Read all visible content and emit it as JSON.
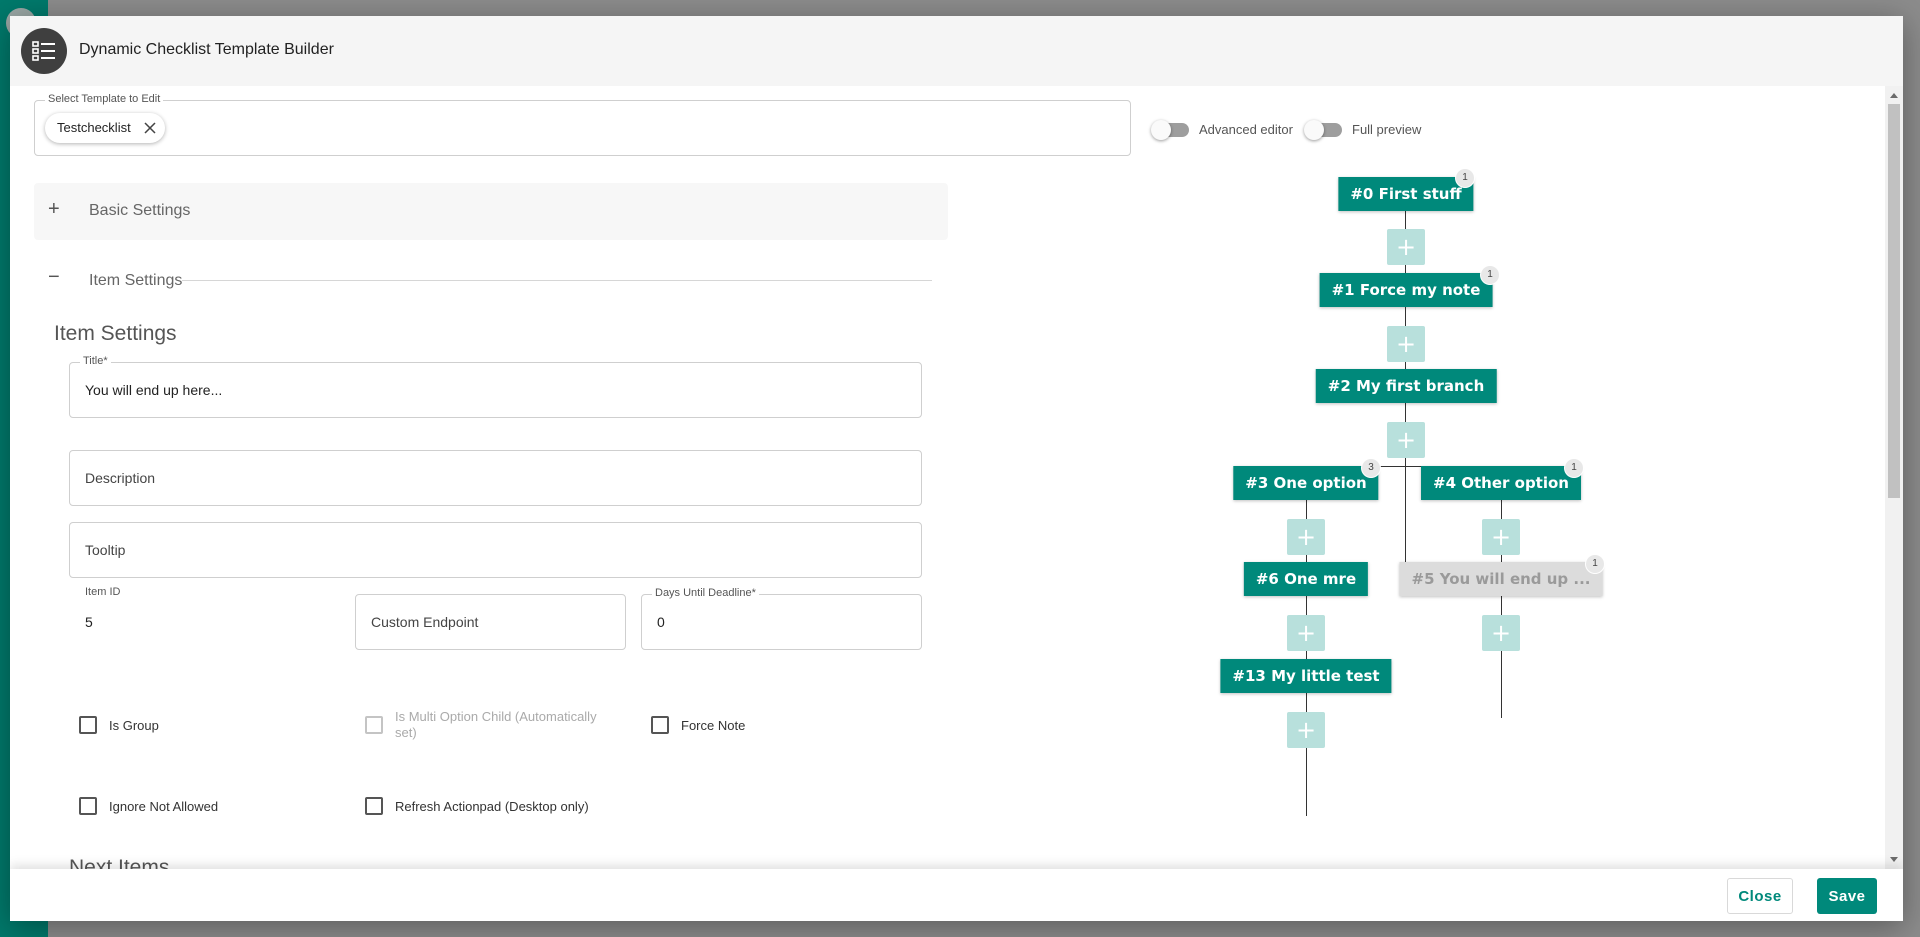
{
  "dialog": {
    "title": "Dynamic Checklist Template Builder"
  },
  "template_select": {
    "label": "Select Template to Edit",
    "chip": "Testchecklist"
  },
  "toggles": {
    "advanced_editor": "Advanced editor",
    "full_preview": "Full preview"
  },
  "sections": {
    "basic": "Basic Settings",
    "item": "Item Settings"
  },
  "item_settings": {
    "heading": "Item Settings",
    "title_label": "Title*",
    "title_value": "You will end up here...",
    "description_placeholder": "Description",
    "tooltip_placeholder": "Tooltip",
    "item_id_label": "Item ID",
    "item_id_value": "5",
    "custom_endpoint_placeholder": "Custom Endpoint",
    "days_label": "Days Until Deadline*",
    "days_value": "0"
  },
  "checkboxes": {
    "is_group": "Is Group",
    "is_multi_option_child": "Is Multi Option Child (Automatically set)",
    "force_note": "Force Note",
    "ignore_not_allowed": "Ignore Not Allowed",
    "refresh_actionpad": "Refresh Actionpad (Desktop only)"
  },
  "next_items": {
    "heading": "Next Items"
  },
  "tree": {
    "nodes": [
      {
        "label": "#0 First stuff",
        "badge": "1"
      },
      {
        "label": "#1 Force my note",
        "badge": "1"
      },
      {
        "label": "#2 My first branch",
        "badge": ""
      },
      {
        "label": "#3 One option",
        "badge": "3"
      },
      {
        "label": "#4 Other option",
        "badge": "1"
      },
      {
        "label": "#6 One mre",
        "badge": ""
      },
      {
        "label": "#5 You will end up ...",
        "badge": "1"
      },
      {
        "label": "#13 My little test",
        "badge": ""
      }
    ],
    "add_symbol": "+"
  },
  "footer": {
    "close": "Close",
    "save": "Save"
  },
  "colors": {
    "accent": "#00897b",
    "add_button": "#b8e0dc",
    "ghost_node": "#dcdcdc"
  }
}
